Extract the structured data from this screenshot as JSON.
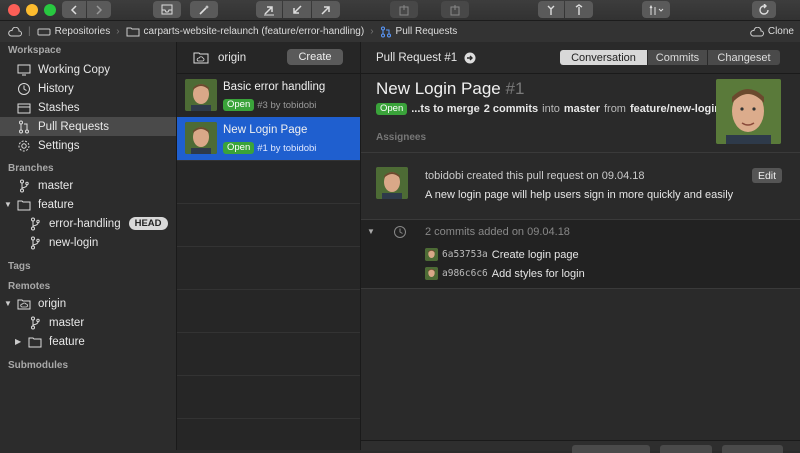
{
  "toolbar": {
    "clone_label": "Clone"
  },
  "pathbar": {
    "repositories": "Repositories",
    "repo": "carparts-website-relaunch (feature/error-handling)",
    "section": "Pull Requests"
  },
  "sidebar": {
    "workspace_header": "Workspace",
    "workspace_items": [
      "Working Copy",
      "History",
      "Stashes",
      "Pull Requests",
      "Settings"
    ],
    "branches_header": "Branches",
    "branch_master": "master",
    "branch_feature": "feature",
    "branch_error_handling": "error-handling",
    "head_badge": "HEAD",
    "branch_new_login": "new-login",
    "tags_header": "Tags",
    "remotes_header": "Remotes",
    "remote_origin": "origin",
    "remote_master": "master",
    "remote_feature": "feature",
    "submodules_header": "Submodules"
  },
  "list": {
    "remote_name": "origin",
    "create_label": "Create",
    "items": [
      {
        "title": "Basic error handling",
        "status": "Open",
        "meta": "#3 by tobidobi"
      },
      {
        "title": "New Login Page",
        "status": "Open",
        "meta": "#1 by tobidobi"
      }
    ]
  },
  "detail": {
    "header_title": "Pull Request #1",
    "tabs": [
      "Conversation",
      "Commits",
      "Changeset"
    ],
    "active_tab": "Conversation",
    "title": "New Login Page",
    "number": "#1",
    "status": "Open",
    "merge_prefix": "...ts to merge",
    "merge_commits": "2 commits",
    "merge_into": "into",
    "merge_target": "master",
    "merge_from": "from",
    "merge_source": "feature/new-login",
    "assignees_label": "Assignees",
    "comment_header": "tobidobi created this pull request on 09.04.18",
    "comment_body": "A new login page will help users sign in more quickly and easily",
    "edit_label": "Edit",
    "commits_added": "2 commits added on 09.04.18",
    "commits": [
      {
        "hash": "6a53753a",
        "message": "Create login page"
      },
      {
        "hash": "a986c6c6",
        "message": "Add styles for login"
      }
    ]
  },
  "colors": {
    "selection": "#1f5fcf",
    "open_badge": "#3aa33a",
    "close": "#fc5f57",
    "minimize": "#fdbc2e",
    "zoom": "#28c840"
  }
}
